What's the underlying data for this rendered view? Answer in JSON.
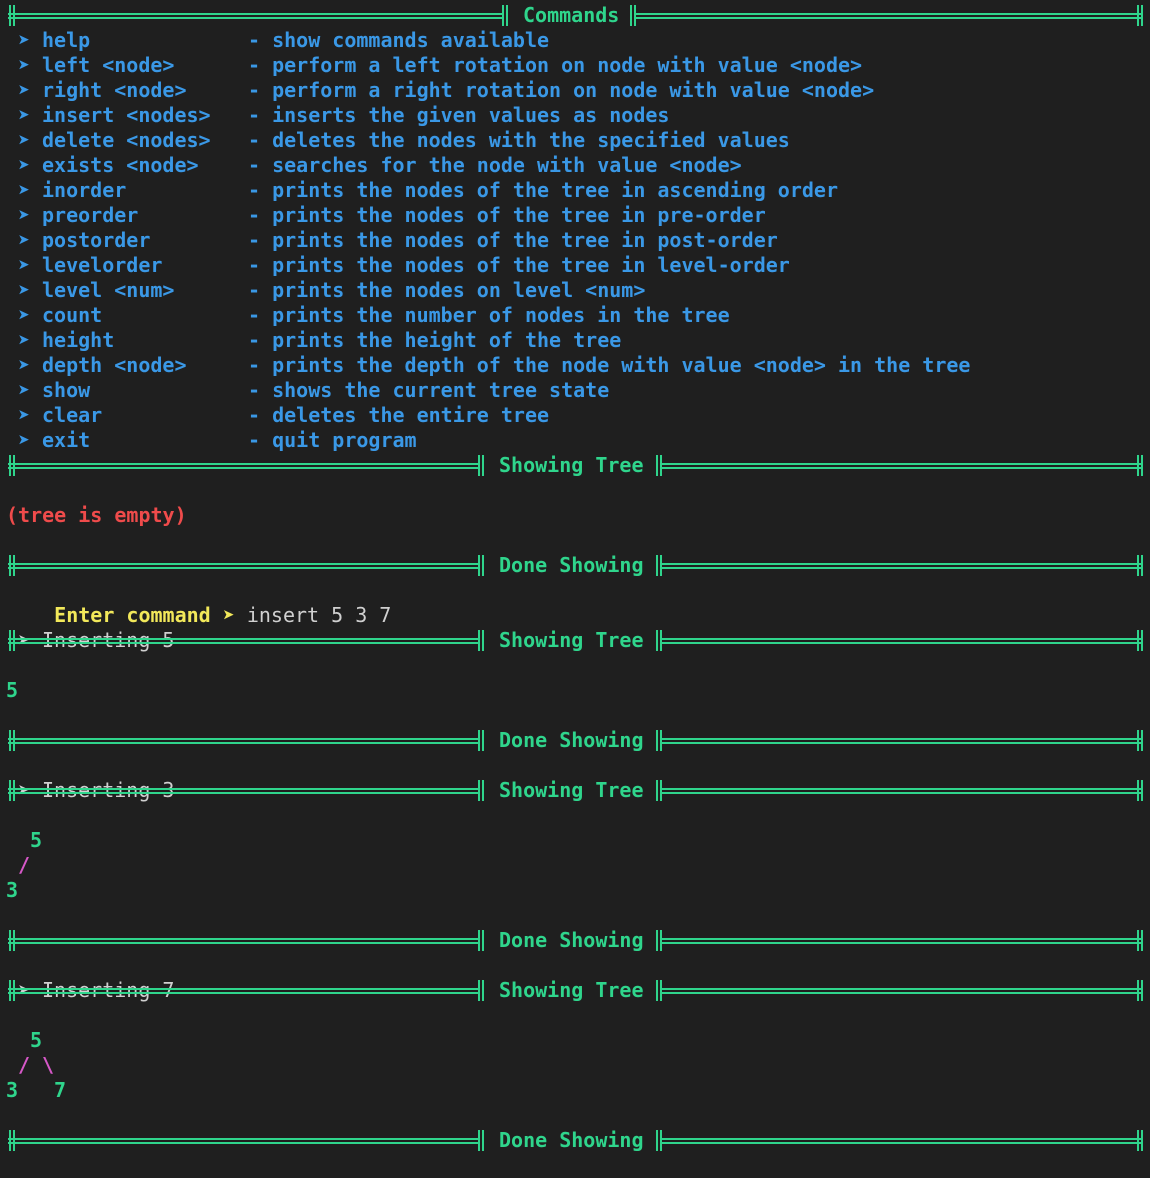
{
  "colors": {
    "background": "#1f1f1f",
    "separator_green": "#2fd58c",
    "command_blue": "#3a98e6",
    "prompt_yellow": "#f2e85a",
    "error_red": "#ef4b4b",
    "branch_pink": "#d658c8",
    "plain_text": "#d0d0d0"
  },
  "bullet_glyph": "➤",
  "commands_header": "Commands",
  "commands": [
    {
      "name": "help",
      "desc": "- show commands available"
    },
    {
      "name": "left <node>",
      "desc": "- perform a left rotation on node with value <node>"
    },
    {
      "name": "right <node>",
      "desc": "- perform a right rotation on node with value <node>"
    },
    {
      "name": "insert <nodes>",
      "desc": "- inserts the given values as nodes"
    },
    {
      "name": "delete <nodes>",
      "desc": "- deletes the nodes with the specified values"
    },
    {
      "name": "exists <node>",
      "desc": "- searches for the node with value <node>"
    },
    {
      "name": "inorder",
      "desc": "- prints the nodes of the tree in ascending order"
    },
    {
      "name": "preorder",
      "desc": "- prints the nodes of the tree in pre-order"
    },
    {
      "name": "postorder",
      "desc": "- prints the nodes of the tree in post-order"
    },
    {
      "name": "levelorder",
      "desc": "- prints the nodes of the tree in level-order"
    },
    {
      "name": "level <num>",
      "desc": "- prints the nodes on level <num>"
    },
    {
      "name": "count",
      "desc": "- prints the number of nodes in the tree"
    },
    {
      "name": "height",
      "desc": "- prints the height of the tree"
    },
    {
      "name": "depth <node>",
      "desc": "- prints the depth of the node with value <node> in the tree"
    },
    {
      "name": "show",
      "desc": "- shows the current tree state"
    },
    {
      "name": "clear",
      "desc": "- deletes the entire tree"
    },
    {
      "name": "exit",
      "desc": "- quit program"
    }
  ],
  "labels": {
    "showing": "Showing Tree",
    "done": "Done Showing",
    "prompt": "Enter command ➤",
    "empty_tree": "(tree is empty)"
  },
  "session": {
    "typed_command": "insert 5 3 7",
    "inserting_1": "Inserting 5",
    "inserting_2": "Inserting 3",
    "inserting_3": "Inserting 7",
    "tree1_root": "5",
    "tree2_root": "5",
    "tree2_branch": "/",
    "tree2_left": "3",
    "tree3_root": "5",
    "tree3_branch_left": "/",
    "tree3_branch_right": "\\",
    "tree3_left": "3",
    "tree3_right": "7"
  }
}
